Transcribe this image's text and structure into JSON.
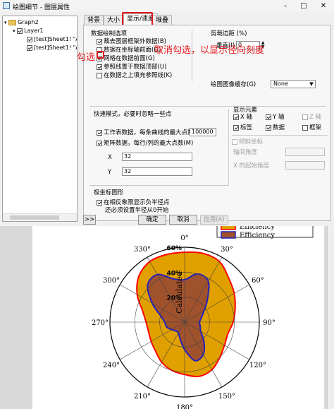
{
  "window": {
    "title": "绘图细节 - 图层属性"
  },
  "tree": {
    "root": "Graph2",
    "layer": "Layer1",
    "plots": [
      "[test]Sheet1! \"An",
      "[test]Sheet1! \"An"
    ]
  },
  "tabs": [
    {
      "label": "背景",
      "active": false
    },
    {
      "label": "大小",
      "active": false
    },
    {
      "label": "显示/速度",
      "active": true
    },
    {
      "label": "堆叠",
      "active": false
    }
  ],
  "data_draw": {
    "title": "数据绘制选项",
    "options": [
      {
        "label": "裁去图层框架外数据(B)",
        "checked": true
      },
      {
        "label": "数据在坐标轴前面(D)",
        "checked": false
      },
      {
        "label": "网格在数据前面(G)",
        "checked": true
      },
      {
        "label": "参照线置于数据顶部(U)",
        "checked": true
      },
      {
        "label": "在数据之上填充参照线(K)",
        "checked": false
      }
    ]
  },
  "clip": {
    "title": "剪裁边距 (%)",
    "vertical_label": "垂直(I)",
    "vertical_value": "0"
  },
  "cache": {
    "label": "绘图图像缓存(G)",
    "value": "None"
  },
  "fast": {
    "title": "快速模式，必要时忽略一些点",
    "worksheet_label": "工作表数据，每条曲线的最大点数",
    "worksheet_checked": true,
    "worksheet_value": "100000",
    "matrix_label": "矩阵数据，每行/列的最大点数(M)",
    "matrix_checked": true,
    "x_label": "X",
    "x_value": "32",
    "y_label": "Y",
    "y_value": "32"
  },
  "display": {
    "title": "显示元素",
    "items": [
      {
        "label": "X 轴",
        "checked": true
      },
      {
        "label": "Y 轴",
        "checked": true
      },
      {
        "label": "Z 轴",
        "checked": false
      },
      {
        "label": "标签",
        "checked": true
      },
      {
        "label": "数据",
        "checked": true
      },
      {
        "label": "框架",
        "checked": false
      }
    ],
    "skew": {
      "title": "倾斜坐标",
      "checked": false,
      "axis_angle": "轴间角度",
      "x_start_angle": "X 的起始角度"
    }
  },
  "polar": {
    "title": "极坐标图形",
    "option_label": "在相反象限显示负半径点",
    "option_label2": "还必须设置半径从0开始",
    "checked": true
  },
  "buttons": {
    "expand": ">>",
    "ok": "确定",
    "cancel": "取消",
    "apply": "应用(A)"
  },
  "annotations": {
    "check_text": "勾选",
    "uncheck_text": "取消勾选，以显示径向刻度",
    "color": "#e2141a"
  },
  "chart_data": {
    "type": "polar-area",
    "angular_ticks": [
      "0°",
      "30°",
      "60°",
      "90°",
      "120°",
      "150°",
      "180°",
      "210°",
      "240°",
      "270°",
      "300°",
      "330°"
    ],
    "radial_ticks": [
      "20%",
      "40%",
      "60%"
    ],
    "radial_axis_label": "Calculated",
    "rlim": [
      0,
      0.6
    ],
    "legend": [
      "Efficiency",
      "Efficiency"
    ],
    "colors": {
      "outer_fill": "#e0a000",
      "outer_stroke": "#ff0000",
      "inner_fill": "#a0522d",
      "inner_stroke": "#2020c0"
    },
    "series": [
      {
        "name": "Efficiency",
        "theta": [
          0,
          15,
          30,
          45,
          60,
          75,
          90,
          105,
          120,
          135,
          150,
          165,
          180,
          195,
          210,
          225,
          240,
          255,
          270,
          285,
          300,
          315,
          330,
          345
        ],
        "r": [
          0.56,
          0.57,
          0.56,
          0.5,
          0.46,
          0.42,
          0.39,
          0.36,
          0.37,
          0.4,
          0.44,
          0.45,
          0.42,
          0.4,
          0.37,
          0.33,
          0.31,
          0.3,
          0.31,
          0.35,
          0.44,
          0.52,
          0.56,
          0.56
        ]
      },
      {
        "name": "Efficiency",
        "theta": [
          0,
          15,
          30,
          45,
          60,
          75,
          90,
          105,
          120,
          135,
          150,
          165,
          180,
          195,
          210,
          225,
          240,
          255,
          270,
          285,
          300,
          315,
          330,
          345
        ],
        "r": [
          0.34,
          0.4,
          0.38,
          0.26,
          0.18,
          0.14,
          0.12,
          0.13,
          0.15,
          0.22,
          0.3,
          0.32,
          0.22,
          0.14,
          0.1,
          0.1,
          0.12,
          0.15,
          0.16,
          0.2,
          0.3,
          0.42,
          0.44,
          0.36
        ]
      }
    ]
  }
}
